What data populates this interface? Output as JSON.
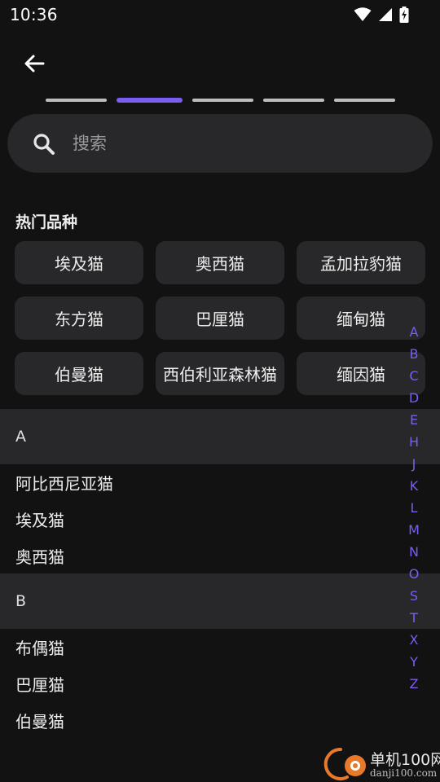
{
  "status_bar": {
    "time": "10:36"
  },
  "search": {
    "placeholder": "搜索",
    "value": ""
  },
  "popular": {
    "title": "热门品种",
    "chips": [
      "埃及猫",
      "奥西猫",
      "孟加拉豹猫",
      "东方猫",
      "巴厘猫",
      "缅甸猫",
      "伯曼猫",
      "西伯利亚森林猫",
      "缅因猫"
    ]
  },
  "step_progress": {
    "total": 5,
    "current": 2
  },
  "sections": [
    {
      "letter": "A",
      "items": [
        "阿比西尼亚猫",
        "埃及猫",
        "奥西猫"
      ]
    },
    {
      "letter": "B",
      "items": [
        "布偶猫",
        "巴厘猫",
        "伯曼猫"
      ]
    }
  ],
  "alphabet_index": [
    "A",
    "B",
    "C",
    "D",
    "E",
    "H",
    "J",
    "K",
    "L",
    "M",
    "N",
    "O",
    "S",
    "T",
    "X",
    "Y",
    "Z"
  ],
  "watermark": {
    "title": "单机100网",
    "subtitle": "danji100.com"
  },
  "colors": {
    "accent": "#7c5cf2",
    "background": "#121213",
    "surface": "#28282a"
  }
}
